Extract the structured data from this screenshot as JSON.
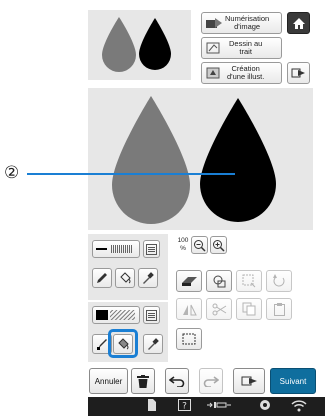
{
  "callout": {
    "number": "②"
  },
  "top_buttons": {
    "scan": "Numérisation\nd'image",
    "line": "Dessin au\ntrait",
    "illust": "Création\nd'une illust."
  },
  "zoom": {
    "value": "100",
    "unit": "%"
  },
  "toolbar": {
    "cancel": "Annuler",
    "next": "Suivant"
  },
  "colors": {
    "gray_shape": "#7a7a7a",
    "black_shape": "#000000",
    "highlight": "#1a7fd4",
    "next_button": "#0f6e9e",
    "status_bar": "#1e1e1e"
  },
  "icons": [
    "home-icon",
    "pencil-icon",
    "bucket-icon",
    "eyedropper-icon",
    "eraser-icon",
    "stamp-icon",
    "select-icon",
    "rotate-icon",
    "mirror-icon",
    "cut-icon",
    "copy-icon",
    "paste-icon",
    "delete-icon",
    "undo-icon",
    "redo-icon",
    "wifi-icon"
  ]
}
